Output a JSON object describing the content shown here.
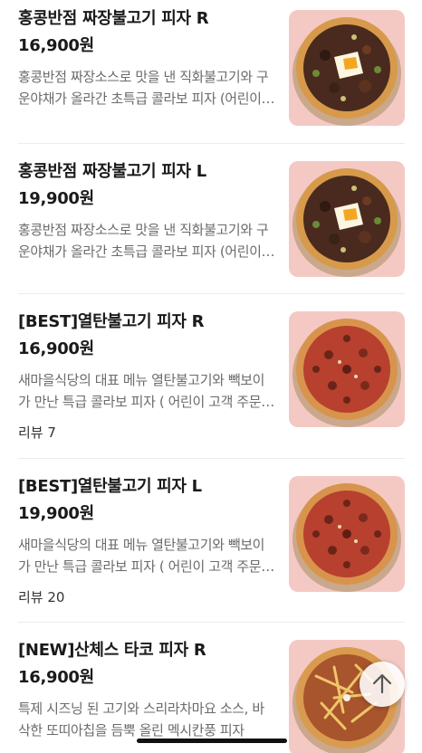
{
  "items": [
    {
      "name": "홍콩반점 짜장불고기 피자 R",
      "price": "16,900원",
      "description": "홍콩반점 짜장소스로 맛을 낸 직화불고기와 구운야채가 올라간 초특급 콜라보 피자 (어린이 고객 주문 시 유의)",
      "review": "",
      "image_icon": "jjajang-bulgogi-pizza-image"
    },
    {
      "name": "홍콩반점 짜장불고기 피자 L",
      "price": "19,900원",
      "description": "홍콩반점 짜장소스로 맛을 낸 직화불고기와 구운야채가 올라간 초특급 콜라보 피자 (어린이 고객 주문 시 유의)",
      "review": "",
      "image_icon": "jjajang-bulgogi-pizza-image"
    },
    {
      "name": "[BEST]열탄불고기 피자 R",
      "price": "16,900원",
      "description": "새마을식당의 대표 메뉴 열탄불고기와 빽보이가 만난 특급 콜라보 피자 ( 어린이 고객 주문 시 유의)",
      "review": "리뷰 7",
      "image_icon": "yeoltan-bulgogi-pizza-image"
    },
    {
      "name": "[BEST]열탄불고기 피자 L",
      "price": "19,900원",
      "description": "새마을식당의 대표 메뉴 열탄불고기와 빽보이가 만난 특급 콜라보 피자 ( 어린이 고객 주문 시 유의)",
      "review": "리뷰 20",
      "image_icon": "yeoltan-bulgogi-pizza-image"
    },
    {
      "name": "[NEW]산체스 타코 피자 R",
      "price": "16,900원",
      "description": "특제 시즈닝 된 고기와 스리라차마요 소스, 바삭한 또띠아칩을 듬뿍 올린 멕시칸풍 피자",
      "review": "",
      "image_icon": "sanchez-taco-pizza-image"
    }
  ],
  "scroll_top_icon": "arrow-up-icon",
  "colors": {
    "text": "#1a1a1a",
    "description": "#6b6b6b",
    "thumb_bg": "#f4c9c4",
    "divider": "#ececec"
  }
}
